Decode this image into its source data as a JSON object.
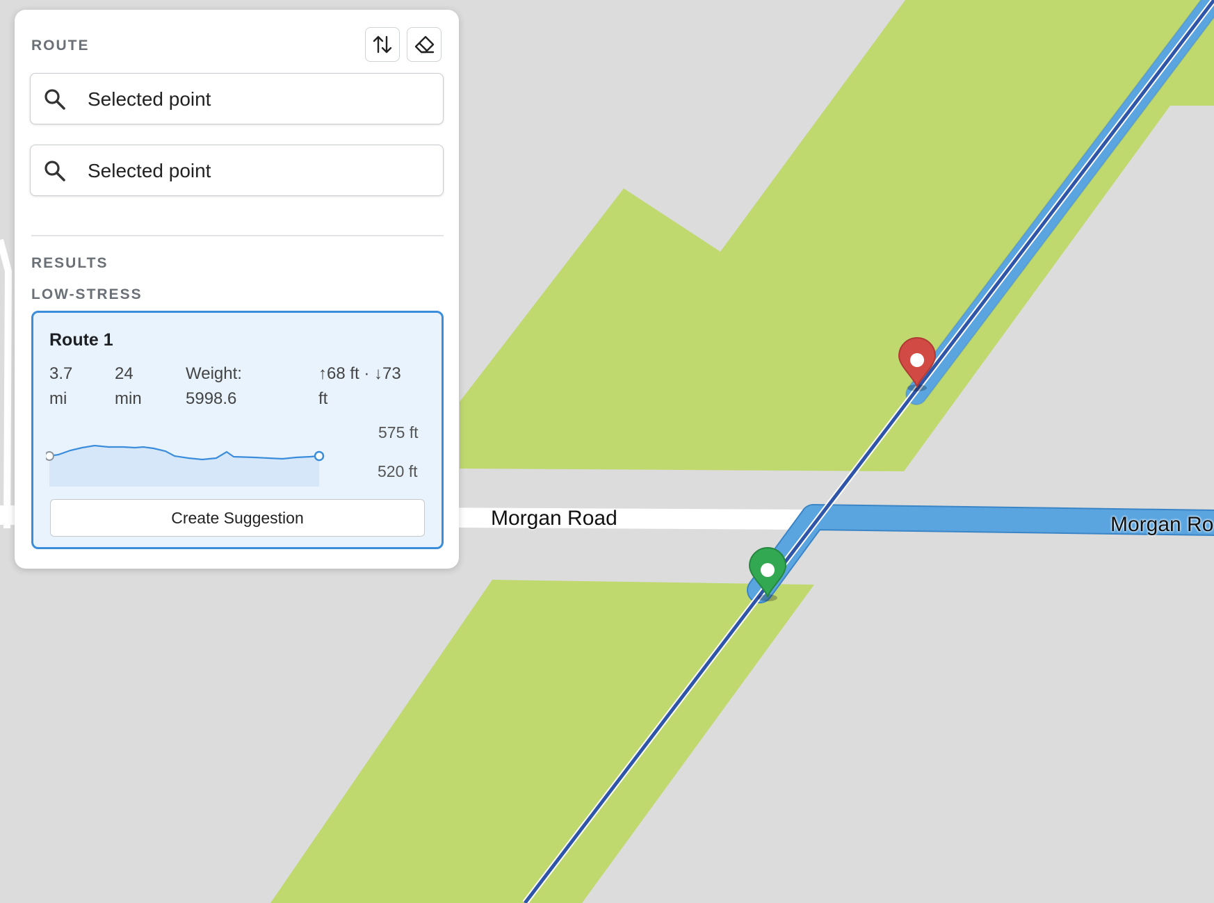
{
  "panel": {
    "route_heading": "ROUTE",
    "origin": {
      "value": "Selected point"
    },
    "destination": {
      "value": "Selected point"
    },
    "results_heading": "RESULTS",
    "group_heading": "LOW-STRESS"
  },
  "route_card": {
    "title": "Route 1",
    "distance_value": "3.7",
    "distance_unit": "mi",
    "time_value": "24",
    "time_unit": "min",
    "weight_label": "Weight:",
    "weight_value": "5998.6",
    "elevation_line1": "↑68 ft · ↓73",
    "elevation_line2": "ft",
    "elevation_max_label": "575 ft",
    "elevation_min_label": "520 ft",
    "create_button": "Create Suggestion"
  },
  "map": {
    "road_label_1": "Morgan Road",
    "road_label_2": "Morgan Ro",
    "colors": {
      "background": "#dcdcdc",
      "park": "#bfd96f",
      "route_casing": "#5aa5e0",
      "route_line": "#2f55a8",
      "start_pin": "#33a852",
      "end_pin": "#d14b44"
    },
    "markers": [
      "start-pin-icon",
      "end-pin-icon"
    ]
  },
  "icons": [
    "swap-icon",
    "eraser-icon",
    "search-icon"
  ]
}
